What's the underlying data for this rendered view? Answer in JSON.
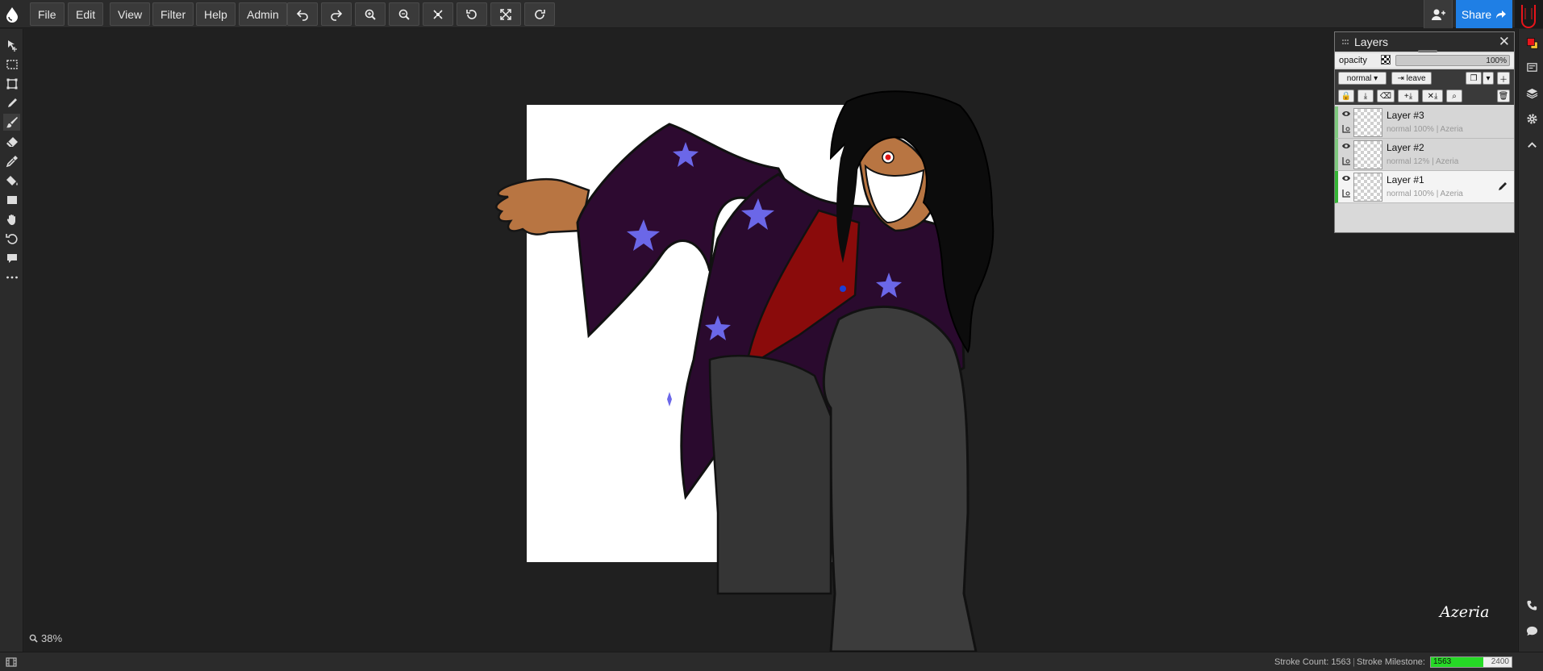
{
  "menu": {
    "file": "File",
    "edit": "Edit",
    "view": "View",
    "filter": "Filter",
    "help": "Help",
    "admin": "Admin"
  },
  "toolbar_icons": [
    "undo-icon",
    "redo-icon",
    "zoom-in-icon",
    "zoom-out-icon",
    "reset-view-icon",
    "rotate-left-icon",
    "fullscreen-icon",
    "rotate-right-icon"
  ],
  "share_label": "Share",
  "colors": {
    "primary": "#e8151b",
    "secondary": "#f4c430",
    "accent": "#1f7fe5",
    "milestone": "#26d926"
  },
  "zoom_level": "38%",
  "signature": "Azeria",
  "status": {
    "stroke_count_label": "Stroke Count: 1563",
    "stroke_milestone_label": "Stroke Milestone:",
    "milestone_current": "1563",
    "milestone_max": "2400",
    "milestone_fraction": 0.651
  },
  "layers_panel": {
    "title": "Layers",
    "opacity_label": "opacity",
    "opacity_value": "100%",
    "blend_mode": "normal",
    "leave_label": "leave",
    "layers": [
      {
        "name": "Layer #3",
        "meta": "normal 100% | Azeria",
        "selected": false
      },
      {
        "name": "Layer #2",
        "meta": "normal 12% | Azeria",
        "selected": false
      },
      {
        "name": "Layer #1",
        "meta": "normal 100% | Azeria",
        "selected": true
      }
    ]
  }
}
